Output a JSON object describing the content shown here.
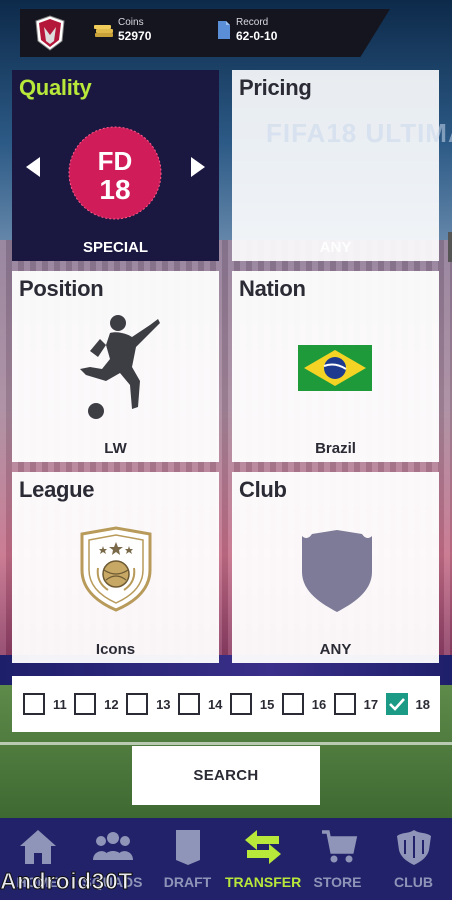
{
  "header": {
    "coins_label": "Coins",
    "coins_value": "52970",
    "record_label": "Record",
    "record_value": "62-0-10"
  },
  "filters": {
    "quality": {
      "title": "Quality",
      "value": "SPECIAL",
      "badge_line1": "FD",
      "badge_line2": "18"
    },
    "pricing": {
      "title": "Pricing",
      "value": "ANY",
      "ghost_text": "FIFA18 ULTIMA"
    },
    "position": {
      "title": "Position",
      "value": "LW"
    },
    "nation": {
      "title": "Nation",
      "value": "Brazil"
    },
    "league": {
      "title": "League",
      "value": "Icons"
    },
    "club": {
      "title": "Club",
      "value": "ANY"
    }
  },
  "ratings": [
    {
      "label": "11",
      "checked": false
    },
    {
      "label": "12",
      "checked": false
    },
    {
      "label": "13",
      "checked": false
    },
    {
      "label": "14",
      "checked": false
    },
    {
      "label": "15",
      "checked": false
    },
    {
      "label": "16",
      "checked": false
    },
    {
      "label": "17",
      "checked": false
    },
    {
      "label": "18",
      "checked": true
    }
  ],
  "search": {
    "label": "SEARCH"
  },
  "nav": [
    {
      "label": "HOME",
      "icon": "home-icon",
      "active": false
    },
    {
      "label": "SQUADS",
      "icon": "squads-icon",
      "active": false
    },
    {
      "label": "DRAFT",
      "icon": "draft-icon",
      "active": false
    },
    {
      "label": "TRANSFER",
      "icon": "transfer-icon",
      "active": true
    },
    {
      "label": "STORE",
      "icon": "store-icon",
      "active": false
    },
    {
      "label": "CLUB",
      "icon": "club-icon",
      "active": false
    }
  ],
  "watermark": "Android30T",
  "colors": {
    "accent": "#b8e83a",
    "nav_bg": "#22226a",
    "check": "#1b9a86",
    "quality_card": "#1a1840",
    "badge": "#d01d5a"
  }
}
